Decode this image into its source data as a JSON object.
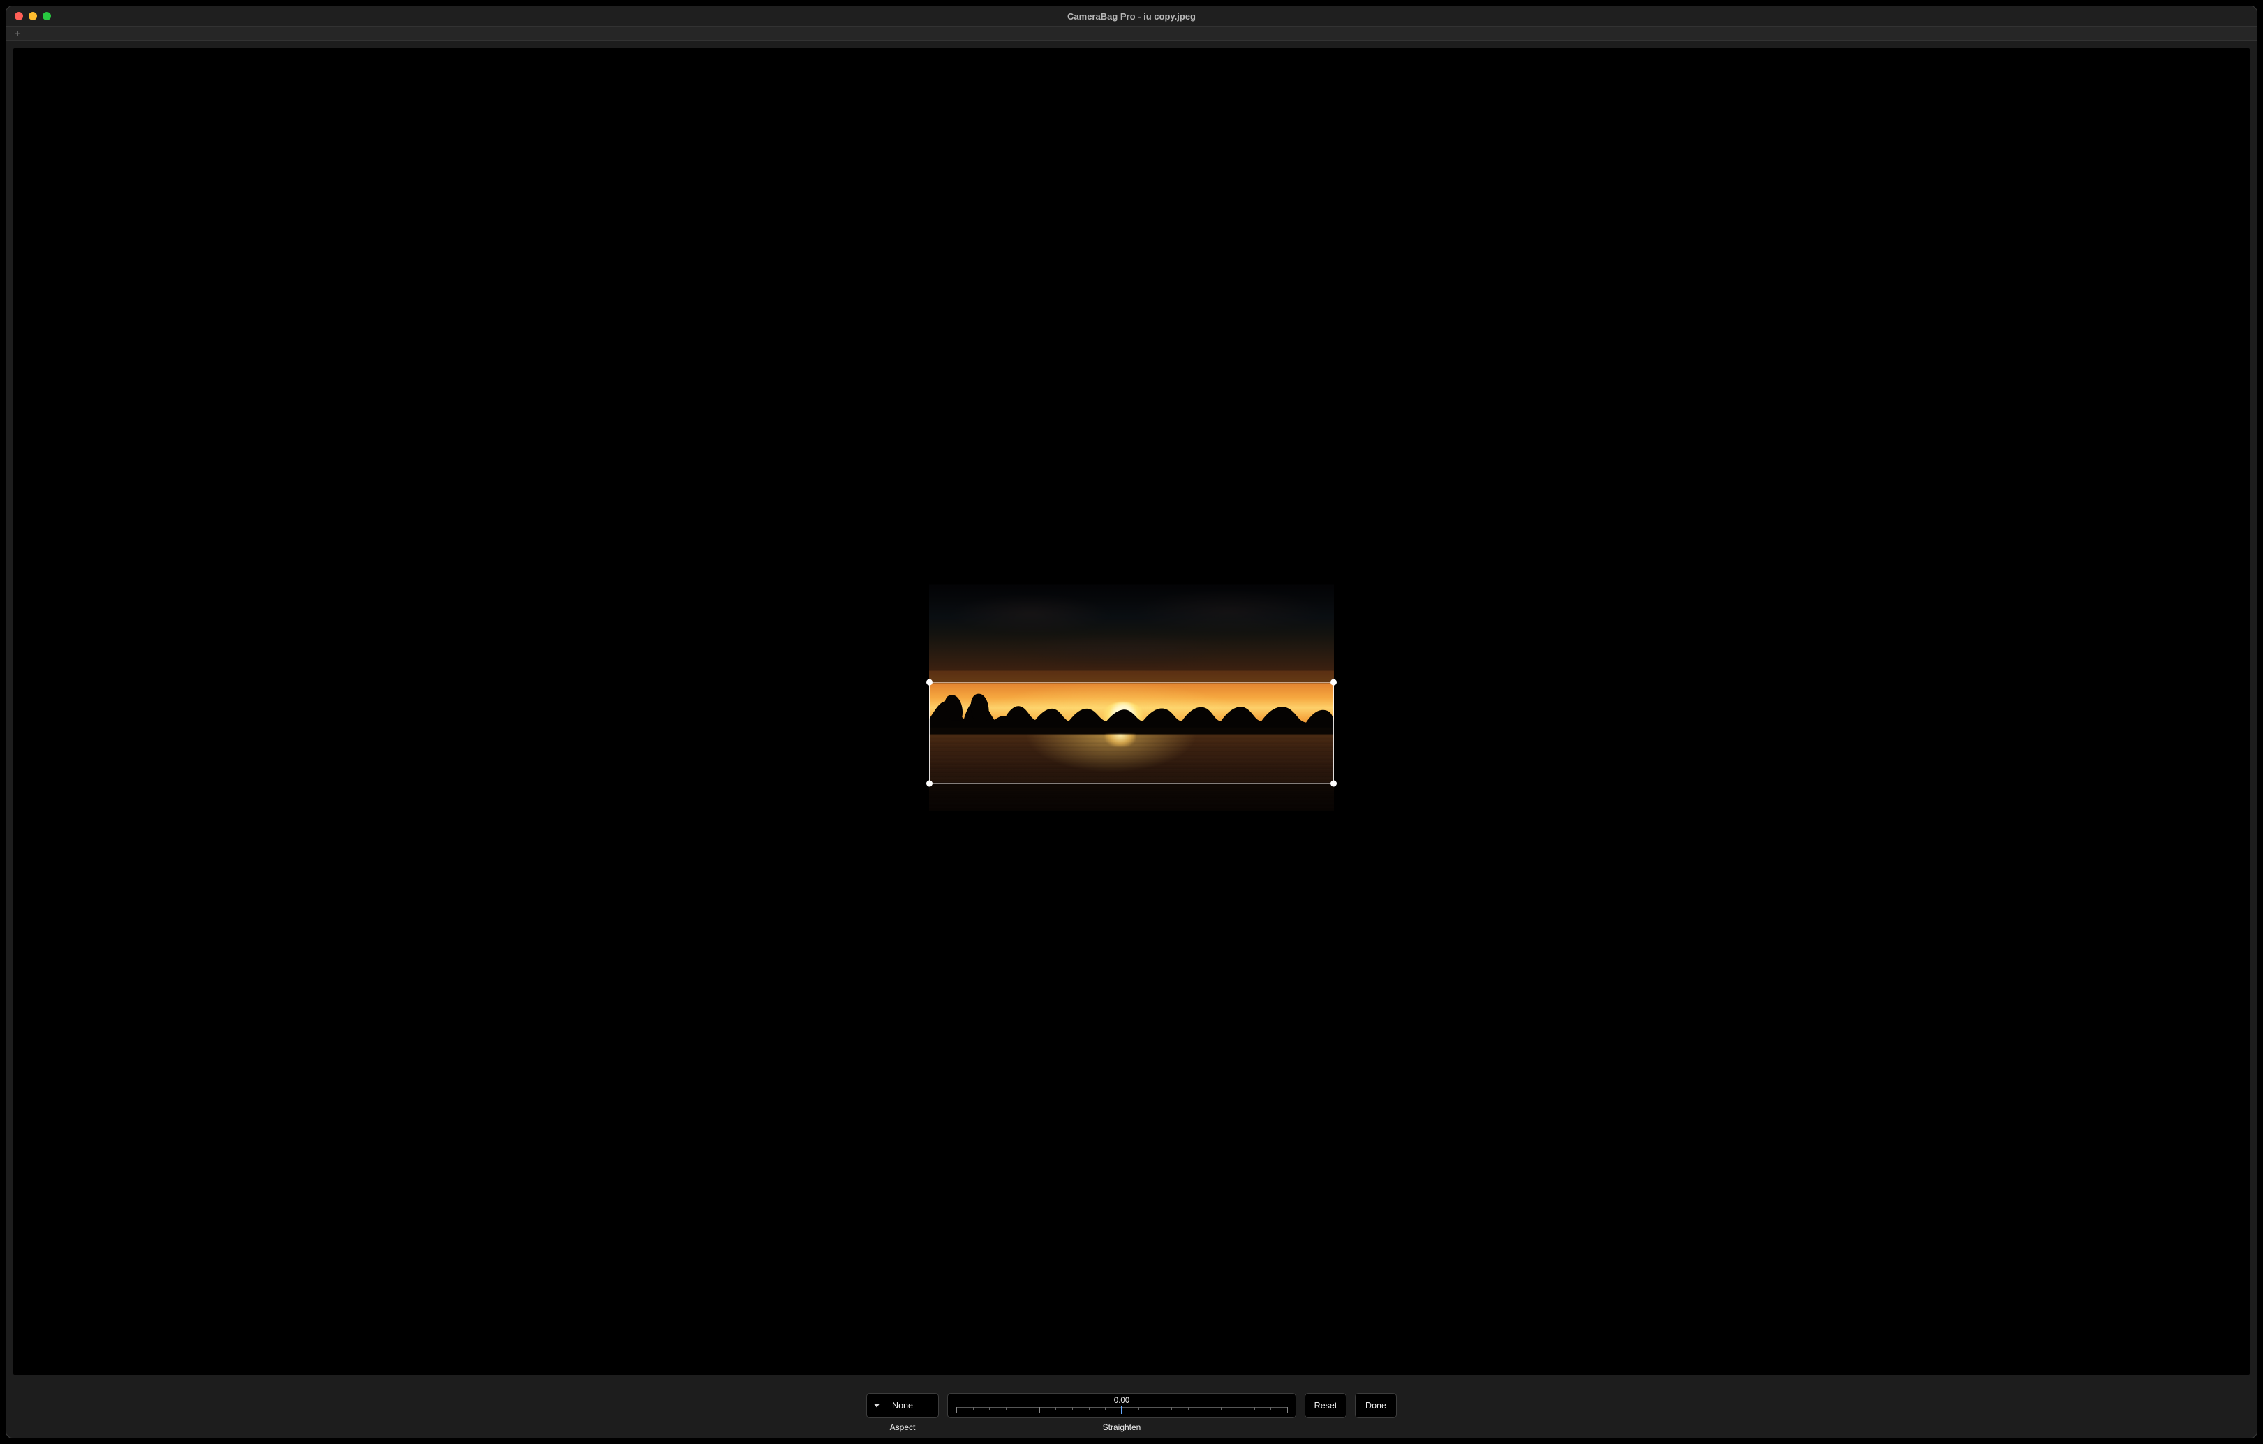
{
  "window": {
    "title": "CameraBag Pro - iu copy.jpeg"
  },
  "tabstrip": {
    "add_icon": "plus-icon"
  },
  "crop": {
    "handles": [
      "tl",
      "tr",
      "bl",
      "br"
    ]
  },
  "toolbar": {
    "aspect": {
      "selected": "None",
      "label": "Aspect"
    },
    "straighten": {
      "value": "0.00",
      "label": "Straighten",
      "marker_position_percent": 50
    },
    "reset_label": "Reset",
    "done_label": "Done"
  }
}
